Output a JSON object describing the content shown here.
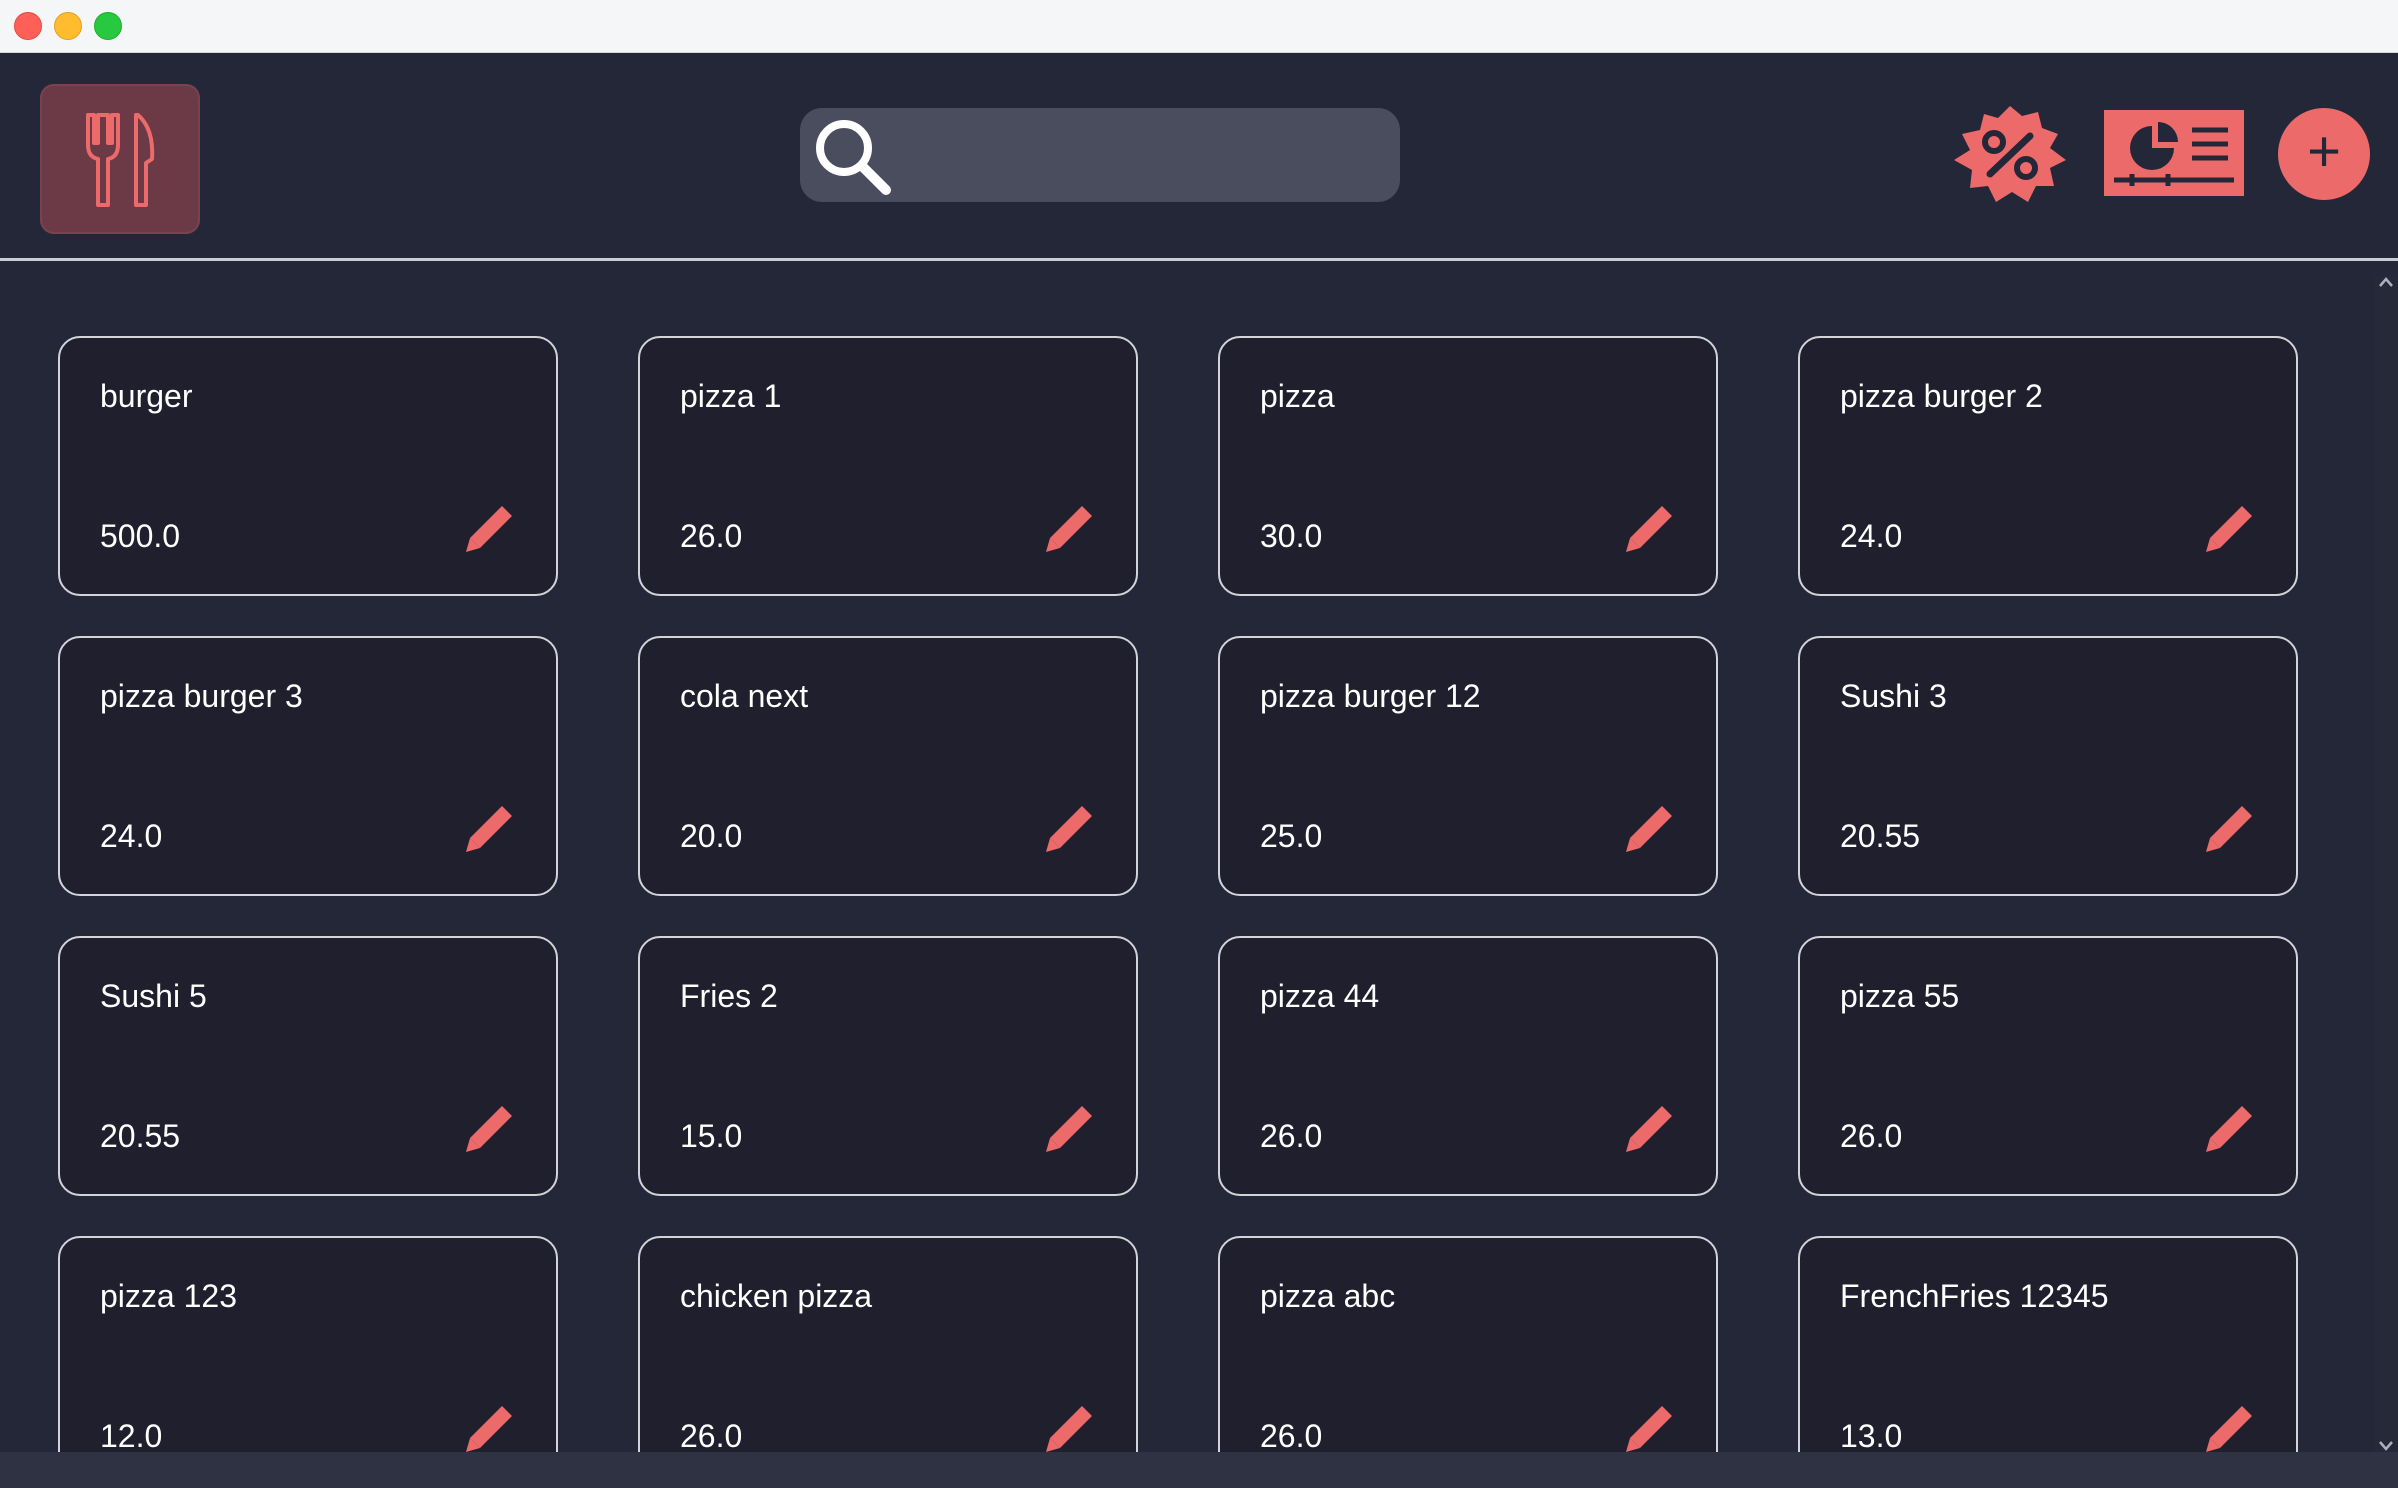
{
  "window": {
    "controls": [
      "close",
      "minimize",
      "maximize"
    ]
  },
  "header": {
    "logo_icon": "fork-knife-icon",
    "search": {
      "icon": "search-icon",
      "placeholder": "",
      "value": ""
    },
    "actions": [
      {
        "icon": "discount-badge-icon"
      },
      {
        "icon": "report-chart-icon"
      },
      {
        "icon": "plus-icon",
        "label": "+"
      }
    ]
  },
  "products": [
    {
      "name": "burger",
      "price": "500.0"
    },
    {
      "name": "pizza 1",
      "price": "26.0"
    },
    {
      "name": "pizza",
      "price": "30.0"
    },
    {
      "name": "pizza burger 2",
      "price": "24.0"
    },
    {
      "name": "pizza burger 3",
      "price": "24.0"
    },
    {
      "name": "cola next",
      "price": "20.0"
    },
    {
      "name": "pizza burger 12",
      "price": "25.0"
    },
    {
      "name": "Sushi 3",
      "price": "20.55"
    },
    {
      "name": "Sushi 5",
      "price": "20.55"
    },
    {
      "name": "Fries 2",
      "price": "15.0"
    },
    {
      "name": "pizza 44",
      "price": "26.0"
    },
    {
      "name": "pizza 55",
      "price": "26.0"
    },
    {
      "name": "pizza 123",
      "price": "12.0"
    },
    {
      "name": "chicken pizza",
      "price": "26.0"
    },
    {
      "name": "pizza abc",
      "price": "26.0"
    },
    {
      "name": "FrenchFries 12345",
      "price": "13.0"
    }
  ],
  "colors": {
    "background": "#242737",
    "card": "#201f2e",
    "accent": "#ec6a6a",
    "logo_tile": "#6b3a46",
    "search_field": "#4a4d5e"
  }
}
